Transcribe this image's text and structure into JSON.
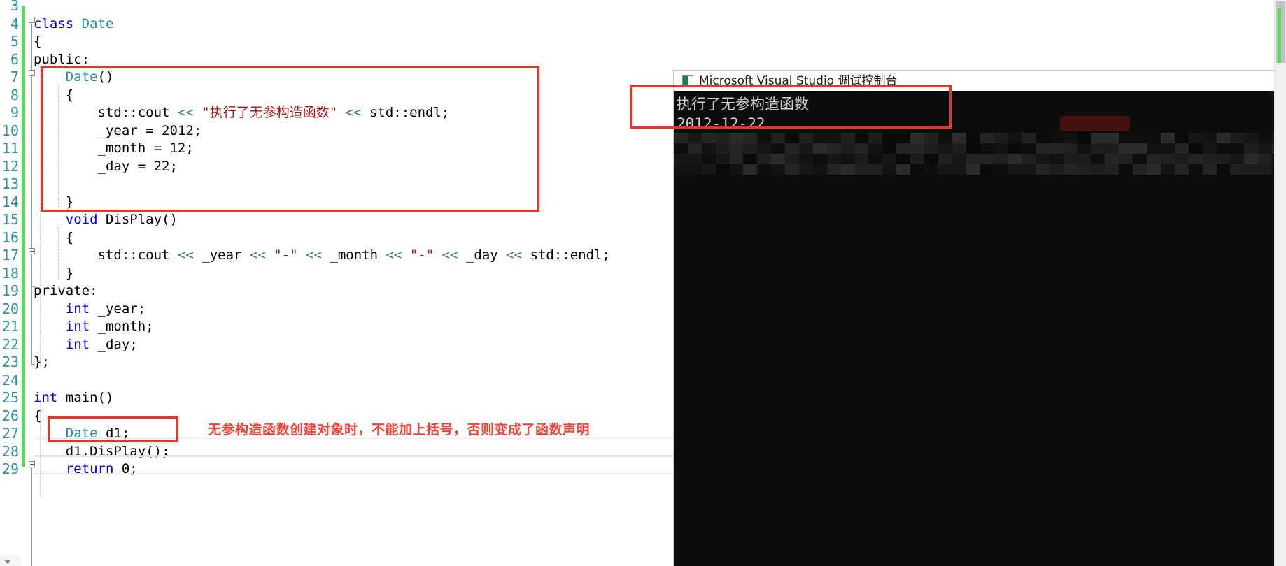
{
  "app": {
    "kind": "visual-studio-code-editor"
  },
  "editor": {
    "line_numbers": [
      "3",
      "4",
      "5",
      "6",
      "7",
      "8",
      "9",
      "10",
      "11",
      "12",
      "13",
      "14",
      "15",
      "16",
      "17",
      "18",
      "19",
      "20",
      "21",
      "22",
      "23",
      "24",
      "25",
      "26",
      "27",
      "28",
      "29"
    ],
    "lines": [
      {
        "n": "3",
        "text": ""
      },
      {
        "n": "4",
        "text": "class Date"
      },
      {
        "n": "5",
        "text": "{"
      },
      {
        "n": "6",
        "text": "public:"
      },
      {
        "n": "7",
        "text": "    Date()"
      },
      {
        "n": "8",
        "text": "    {"
      },
      {
        "n": "9",
        "text": "        std::cout << \"执行了无参构造函数\" << std::endl;"
      },
      {
        "n": "10",
        "text": "        _year = 2012;"
      },
      {
        "n": "11",
        "text": "        _month = 12;"
      },
      {
        "n": "12",
        "text": "        _day = 22;"
      },
      {
        "n": "13",
        "text": ""
      },
      {
        "n": "14",
        "text": "    }"
      },
      {
        "n": "15",
        "text": "    void DisPlay()"
      },
      {
        "n": "16",
        "text": "    {"
      },
      {
        "n": "17",
        "text": "        std::cout << _year << \"-\" << _month << \"-\" << _day << std::endl;"
      },
      {
        "n": "18",
        "text": "    }"
      },
      {
        "n": "19",
        "text": "private:"
      },
      {
        "n": "20",
        "text": "    int _year;"
      },
      {
        "n": "21",
        "text": "    int _month;"
      },
      {
        "n": "22",
        "text": "    int _day;"
      },
      {
        "n": "23",
        "text": "};"
      },
      {
        "n": "24",
        "text": ""
      },
      {
        "n": "25",
        "text": "int main()"
      },
      {
        "n": "26",
        "text": "{"
      },
      {
        "n": "27",
        "text": "    Date d1;"
      },
      {
        "n": "28",
        "text": "    d1.DisPlay();"
      },
      {
        "n": "29",
        "text": "    return 0;"
      }
    ],
    "tokens": {
      "class_kw": "class",
      "class_name": "Date",
      "public_kw": "public:",
      "private_kw": "private:",
      "void_kw": "void",
      "int_kw": "int",
      "return_kw": "return",
      "ctor_name": "Date()",
      "method_name": "DisPlay()",
      "string_literal": "\"执行了无参构造函数\"",
      "dash_literal": "\"-\"",
      "std_cout": "std::cout",
      "std_endl": "std::endl",
      "shift_op": "<<"
    },
    "colors": {
      "keyword": "#0000ff",
      "type": "#2b91af",
      "string": "#a31515",
      "operator": "#3f7f7f",
      "line_number": "#2b91af",
      "change_bar": "#60d460",
      "background": "#ffffff"
    }
  },
  "annotations": {
    "accent_color": "#ee3224",
    "note_color": "#f04236",
    "note_text": "无参构造函数创建对象时，不能加上括号，否则变成了函数声明",
    "box_constructor_label": "constructor-highlight-box",
    "box_object_label": "object-declaration-highlight-box",
    "box_console_label": "console-output-highlight-box"
  },
  "console": {
    "title": "Microsoft Visual Studio 调试控制台",
    "icon": "console-window-icon",
    "output_lines": [
      "执行了无参构造函数",
      "2012-12-22"
    ],
    "background": "#0c0c0c",
    "text_color": "#cccccc"
  },
  "scrollbar": {
    "vertical_label": "vertical-scrollbar",
    "marker_color": "#57d957"
  }
}
